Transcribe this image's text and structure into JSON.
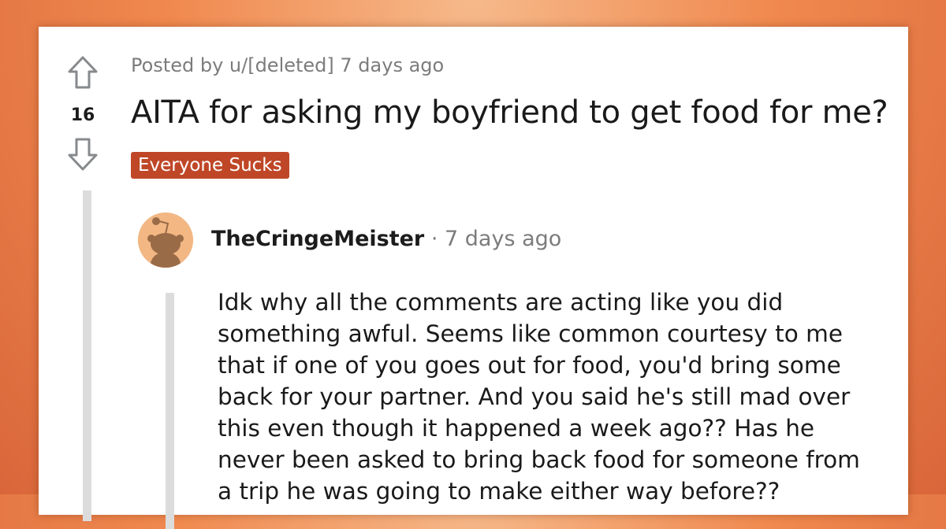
{
  "post": {
    "posted_by": "Posted by u/[deleted] 7 days ago",
    "score": "16",
    "title": "AITA for asking my boyfriend to get food for me?",
    "flair": "Everyone Sucks"
  },
  "comment": {
    "username": "TheCringeMeister",
    "separator": "·",
    "time": "7 days ago",
    "body": "Idk why all the comments are acting like you did\nsomething awful. Seems like common courtesy to me\nthat if one of you goes out for food, you'd bring some\nback for your partner. And you said he's still mad over\nthis even though it happened a week ago?? Has he\nnever been asked to bring back food for someone from\na trip he was going to make either way before??"
  },
  "colors": {
    "background": "#f0894f",
    "flair": "#bf4727",
    "avatar": "#f2b783",
    "text": "#1a1a1b",
    "muted": "#7c7c7c"
  },
  "icons": {
    "upvote": "arrow-up-outline",
    "downvote": "arrow-down-outline",
    "avatar": "reddit-snoo"
  }
}
